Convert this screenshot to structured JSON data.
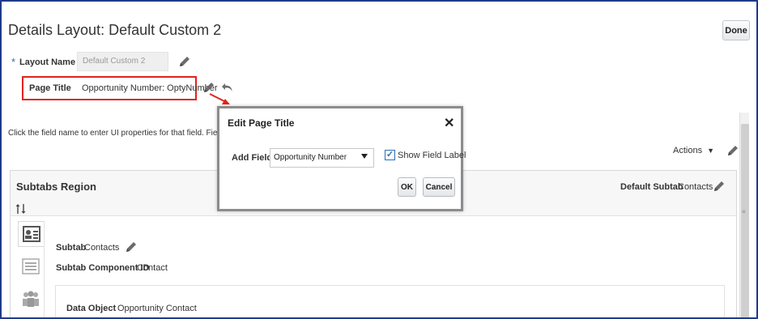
{
  "page": {
    "title": "Details Layout: Default Custom 2",
    "done_label": "Done"
  },
  "layout_name": {
    "required_mark": "*",
    "label": "Layout Name",
    "value": "Default Custom 2"
  },
  "page_title": {
    "label": "Page Title",
    "value": "Opportunity Number: OptyNumber"
  },
  "instructions": "Click the field name to enter UI properties for that field. Fields wh",
  "instructions_tail": "e",
  "actions_label": "Actions",
  "subtabs_region": {
    "title": "Subtabs Region",
    "default_subtab_label": "Default Subtab",
    "default_subtab_value": "Contacts",
    "subtab_label": "Subtab",
    "subtab_value": "Contacts",
    "component_id_label": "Subtab Component ID",
    "component_id_value": "Contact",
    "data_object_label": "Data Object",
    "data_object_value": "Opportunity Contact",
    "icons": [
      "contact-card-icon",
      "list-icon",
      "people-icon"
    ]
  },
  "dialog": {
    "title": "Edit Page Title",
    "close_glyph": "✕",
    "add_field_label": "Add Field",
    "add_field_value": "Opportunity Number",
    "show_field_label": "Show Field Label",
    "show_field_label_checked": true,
    "check_glyph": "✓",
    "ok_label": "OK",
    "cancel_label": "Cancel"
  },
  "colors": {
    "highlight": "#e2231a",
    "accent": "#2a6ebb",
    "frame": "#1f3a8a"
  }
}
